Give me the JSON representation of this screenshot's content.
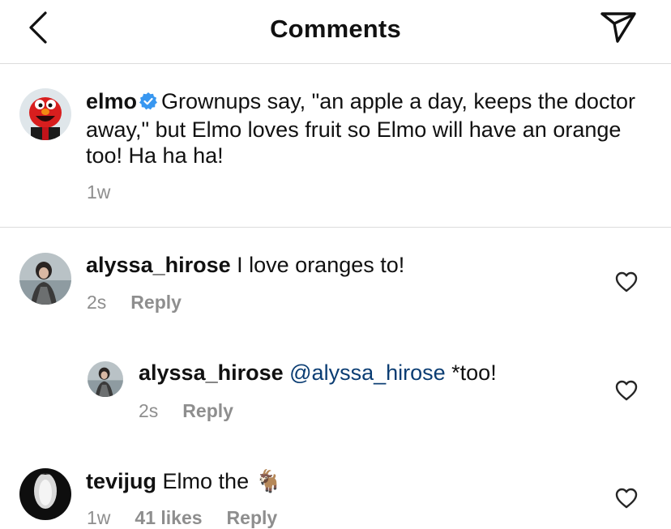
{
  "header": {
    "title": "Comments"
  },
  "caption": {
    "username": "elmo",
    "text": "Grownups say, \"an apple a day, keeps the doctor away,\" but Elmo loves fruit so Elmo will have an orange too! Ha ha ha!",
    "time": "1w"
  },
  "comments": [
    {
      "username": "alyssa_hirose",
      "text": "I love oranges to!",
      "time": "2s",
      "reply_label": "Reply"
    },
    {
      "username": "alyssa_hirose",
      "mention": "@alyssa_hirose",
      "text": "*too!",
      "time": "2s",
      "reply_label": "Reply"
    },
    {
      "username": "tevijug",
      "text": "Elmo the 🐐",
      "time": "1w",
      "likes": "41 likes",
      "reply_label": "Reply"
    }
  ],
  "colors": {
    "mention": "#0b3d73",
    "meta": "#8e8e8e",
    "verified": "#3897f0"
  },
  "icons": [
    "back-arrow-icon",
    "send-icon",
    "verified-badge-icon",
    "heart-icon"
  ]
}
